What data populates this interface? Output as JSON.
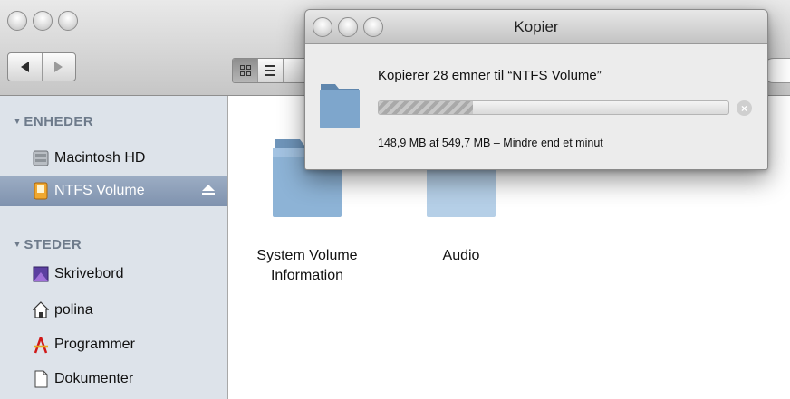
{
  "finder": {
    "view_modes": [
      "icon-view",
      "list-view",
      "column-view"
    ],
    "sidebar": {
      "sections": [
        {
          "heading": "ENHEDER",
          "items": [
            {
              "label": "Macintosh HD",
              "icon": "hard-drive-icon"
            },
            {
              "label": "NTFS Volume",
              "icon": "external-drive-icon",
              "selected": true,
              "eject": "eject-icon"
            }
          ]
        },
        {
          "heading": "STEDER",
          "items": [
            {
              "label": "Skrivebord",
              "icon": "desktop-icon"
            },
            {
              "label": "polina",
              "icon": "home-icon"
            },
            {
              "label": "Programmer",
              "icon": "applications-icon"
            },
            {
              "label": "Dokumenter",
              "icon": "documents-icon"
            }
          ]
        }
      ]
    },
    "content": {
      "items": [
        {
          "label_line1": "System Volume",
          "label_line2": "Information",
          "icon": "folder-icon"
        },
        {
          "label_line1": "Audio",
          "label_line2": "",
          "icon": "folder-icon"
        }
      ]
    }
  },
  "copy_dialog": {
    "title": "Kopier",
    "message": "Kopierer 28 emner til “NTFS Volume”",
    "progress_fraction": 0.27,
    "status": "148,9 MB af 549,7 MB – Mindre end et minut",
    "stop_icon": "stop-icon"
  },
  "colors": {
    "sidebar_bg": "#dde3ea",
    "selection": "#8597b2",
    "folder_blue": "#7fa6c7"
  }
}
